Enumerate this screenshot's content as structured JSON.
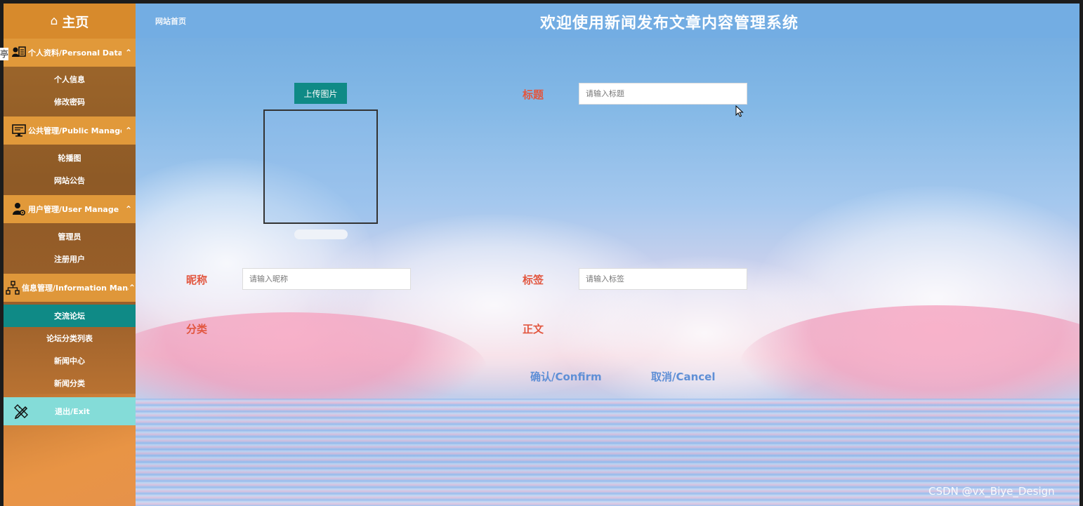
{
  "stray_glyph": "亭",
  "sidebar": {
    "home_icon": "⌂",
    "home_label": "主页",
    "groups": [
      {
        "label": "个人资料/Personal Data",
        "icon": "id-card-icon",
        "caret": "⌃",
        "items": [
          "个人信息",
          "修改密码"
        ]
      },
      {
        "label": "公共管理/Public Manage",
        "icon": "monitor-icon",
        "caret": "⌃",
        "items": [
          "轮播图",
          "网站公告"
        ]
      },
      {
        "label": "用户管理/User Manage",
        "icon": "user-gear-icon",
        "caret": "⌃",
        "items": [
          "管理员",
          "注册用户"
        ]
      },
      {
        "label": "信息管理/Information Manage",
        "icon": "sitemap-icon",
        "caret": "⌃",
        "items": [
          "交流论坛",
          "论坛分类列表",
          "新闻中心",
          "新闻分类"
        ]
      }
    ],
    "active_item": "交流论坛",
    "exit_label": "退出/Exit"
  },
  "header": {
    "breadcrumb": "网站首页",
    "title": "欢迎使用新闻发布文章内容管理系统"
  },
  "form": {
    "upload_label": "上传图片",
    "title_label": "标题",
    "title_placeholder": "请输入标题",
    "nickname_label": "昵称",
    "nickname_placeholder": "请输入昵称",
    "tag_label": "标签",
    "tag_placeholder": "请输入标签",
    "category_label": "分类",
    "content_label": "正文",
    "confirm_label": "确认/Confirm",
    "cancel_label": "取消/Cancel"
  },
  "watermark": "CSDN @vx_Biye_Design",
  "colors": {
    "sidebar_header": "#e1993a",
    "active_item": "#0f8a86",
    "exit_bg": "#84dcd8",
    "topbar": "#73ade3",
    "label_red": "#e2563f",
    "action_blue": "#5f8fd6"
  }
}
